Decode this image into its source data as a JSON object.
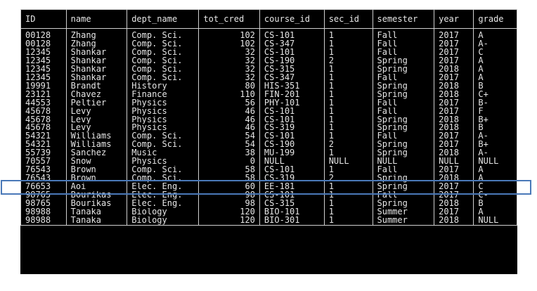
{
  "columns": [
    "ID",
    "name",
    "dept_name",
    "tot_cred",
    "course_id",
    "sec_id",
    "semester",
    "year",
    "grade"
  ],
  "rows": [
    [
      "00128",
      "Zhang",
      "Comp. Sci.",
      "102",
      "CS-101",
      "1",
      "Fall",
      "2017",
      "A"
    ],
    [
      "00128",
      "Zhang",
      "Comp. Sci.",
      "102",
      "CS-347",
      "1",
      "Fall",
      "2017",
      "A-"
    ],
    [
      "12345",
      "Shankar",
      "Comp. Sci.",
      "32",
      "CS-101",
      "1",
      "Fall",
      "2017",
      "C"
    ],
    [
      "12345",
      "Shankar",
      "Comp. Sci.",
      "32",
      "CS-190",
      "2",
      "Spring",
      "2017",
      "A"
    ],
    [
      "12345",
      "Shankar",
      "Comp. Sci.",
      "32",
      "CS-315",
      "1",
      "Spring",
      "2018",
      "A"
    ],
    [
      "12345",
      "Shankar",
      "Comp. Sci.",
      "32",
      "CS-347",
      "1",
      "Fall",
      "2017",
      "A"
    ],
    [
      "19991",
      "Brandt",
      "History",
      "80",
      "HIS-351",
      "1",
      "Spring",
      "2018",
      "B"
    ],
    [
      "23121",
      "Chavez",
      "Finance",
      "110",
      "FIN-201",
      "1",
      "Spring",
      "2018",
      "C+"
    ],
    [
      "44553",
      "Peltier",
      "Physics",
      "56",
      "PHY-101",
      "1",
      "Fall",
      "2017",
      "B-"
    ],
    [
      "45678",
      "Levy",
      "Physics",
      "46",
      "CS-101",
      "1",
      "Fall",
      "2017",
      "F"
    ],
    [
      "45678",
      "Levy",
      "Physics",
      "46",
      "CS-101",
      "1",
      "Spring",
      "2018",
      "B+"
    ],
    [
      "45678",
      "Levy",
      "Physics",
      "46",
      "CS-319",
      "1",
      "Spring",
      "2018",
      "B"
    ],
    [
      "54321",
      "Williams",
      "Comp. Sci.",
      "54",
      "CS-101",
      "1",
      "Fall",
      "2017",
      "A-"
    ],
    [
      "54321",
      "Williams",
      "Comp. Sci.",
      "54",
      "CS-190",
      "2",
      "Spring",
      "2017",
      "B+"
    ],
    [
      "55739",
      "Sanchez",
      "Music",
      "38",
      "MU-199",
      "1",
      "Spring",
      "2018",
      "A-"
    ],
    [
      "70557",
      "Snow",
      "Physics",
      "0",
      "NULL",
      "NULL",
      "NULL",
      "NULL",
      "NULL"
    ],
    [
      "76543",
      "Brown",
      "Comp. Sci.",
      "58",
      "CS-101",
      "1",
      "Fall",
      "2017",
      "A"
    ],
    [
      "76543",
      "Brown",
      "Comp. Sci.",
      "58",
      "CS-319",
      "2",
      "Spring",
      "2018",
      "A"
    ],
    [
      "76653",
      "Aoi",
      "Elec. Eng.",
      "60",
      "EE-181",
      "1",
      "Spring",
      "2017",
      "C"
    ],
    [
      "98765",
      "Bourikas",
      "Elec. Eng.",
      "98",
      "CS-101",
      "1",
      "Fall",
      "2017",
      "C-"
    ],
    [
      "98765",
      "Bourikas",
      "Elec. Eng.",
      "98",
      "CS-315",
      "1",
      "Spring",
      "2018",
      "B"
    ],
    [
      "98988",
      "Tanaka",
      "Biology",
      "120",
      "BIO-101",
      "1",
      "Summer",
      "2017",
      "A"
    ],
    [
      "98988",
      "Tanaka",
      "Biology",
      "120",
      "BIO-301",
      "1",
      "Summer",
      "2018",
      "NULL"
    ]
  ],
  "colors": {
    "console_bg": "#000000",
    "text": "#e6e6e6",
    "highlight_border": "#4a79b8"
  }
}
